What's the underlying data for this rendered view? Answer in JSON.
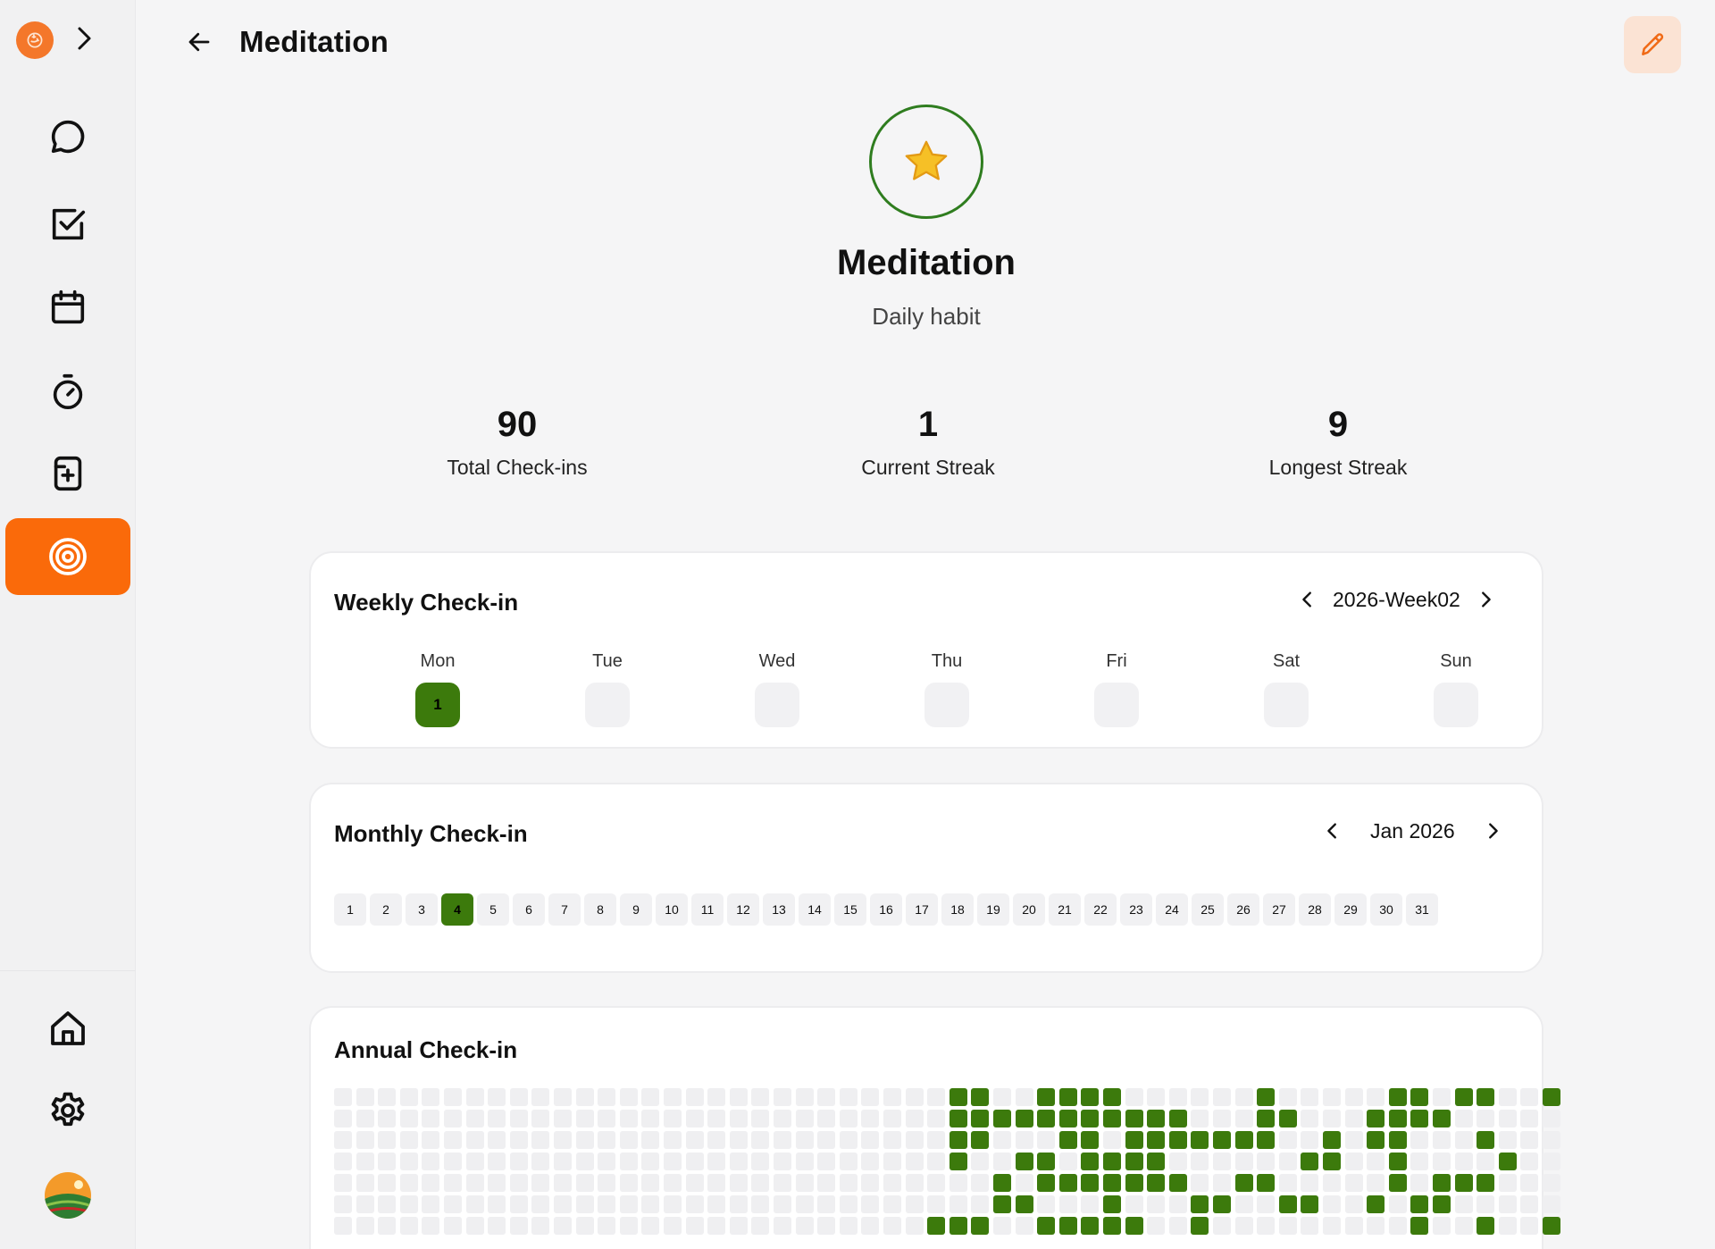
{
  "header": {
    "title": "Meditation"
  },
  "sidebar": {
    "items": [
      {
        "name": "chat",
        "icon": "chat-bubble-icon"
      },
      {
        "name": "tasks",
        "icon": "checkbox-icon"
      },
      {
        "name": "calendar",
        "icon": "calendar-icon"
      },
      {
        "name": "timer",
        "icon": "stopwatch-icon"
      },
      {
        "name": "notes",
        "icon": "note-add-icon"
      },
      {
        "name": "habits",
        "icon": "target-icon",
        "active": true
      }
    ],
    "bottom": [
      {
        "name": "home",
        "icon": "home-icon"
      },
      {
        "name": "settings",
        "icon": "gear-icon"
      }
    ]
  },
  "habit": {
    "name": "Meditation",
    "subtitle": "Daily habit",
    "icon": "star-icon"
  },
  "stats": [
    {
      "value": "90",
      "label": "Total Check-ins"
    },
    {
      "value": "1",
      "label": "Current Streak"
    },
    {
      "value": "9",
      "label": "Longest Streak"
    }
  ],
  "weekly": {
    "title": "Weekly Check-in",
    "period": "2026-Week02",
    "days": [
      {
        "name": "Mon",
        "mark": "1",
        "checked": true
      },
      {
        "name": "Tue",
        "mark": "",
        "checked": false
      },
      {
        "name": "Wed",
        "mark": "",
        "checked": false
      },
      {
        "name": "Thu",
        "mark": "",
        "checked": false
      },
      {
        "name": "Fri",
        "mark": "",
        "checked": false
      },
      {
        "name": "Sat",
        "mark": "",
        "checked": false
      },
      {
        "name": "Sun",
        "mark": "",
        "checked": false
      }
    ]
  },
  "monthly": {
    "title": "Monthly Check-in",
    "period": "Jan 2026",
    "days": [
      "1",
      "2",
      "3",
      "4",
      "5",
      "6",
      "7",
      "8",
      "9",
      "10",
      "11",
      "12",
      "13",
      "14",
      "15",
      "16",
      "17",
      "18",
      "19",
      "20",
      "21",
      "22",
      "23",
      "24",
      "25",
      "26",
      "27",
      "28",
      "29",
      "30",
      "31"
    ],
    "checked": [
      "4"
    ]
  },
  "annual": {
    "title": "Annual Check-in",
    "weeks": 54,
    "rows": [
      "............................~~..~~~~......~.....~~.~~..~",
      "............................~~~~~~~~~~~...~~...~~~~.....",
      "............................~~...~~.~~~~~~~..~.~~...~...",
      "............................~..~~.~~~~......~~..~....~..",
      "..............................~.~~~~~~~..~~.....~.~~~...",
      "..............................~~...~...~~..~~..~.~~.....",
      "...........................~~~..~~~~~..~.........~..~..~"
    ]
  },
  "colors": {
    "accent": "#fa6a0a",
    "checked": "#3c7a0c",
    "empty": "#f1f1f3"
  }
}
